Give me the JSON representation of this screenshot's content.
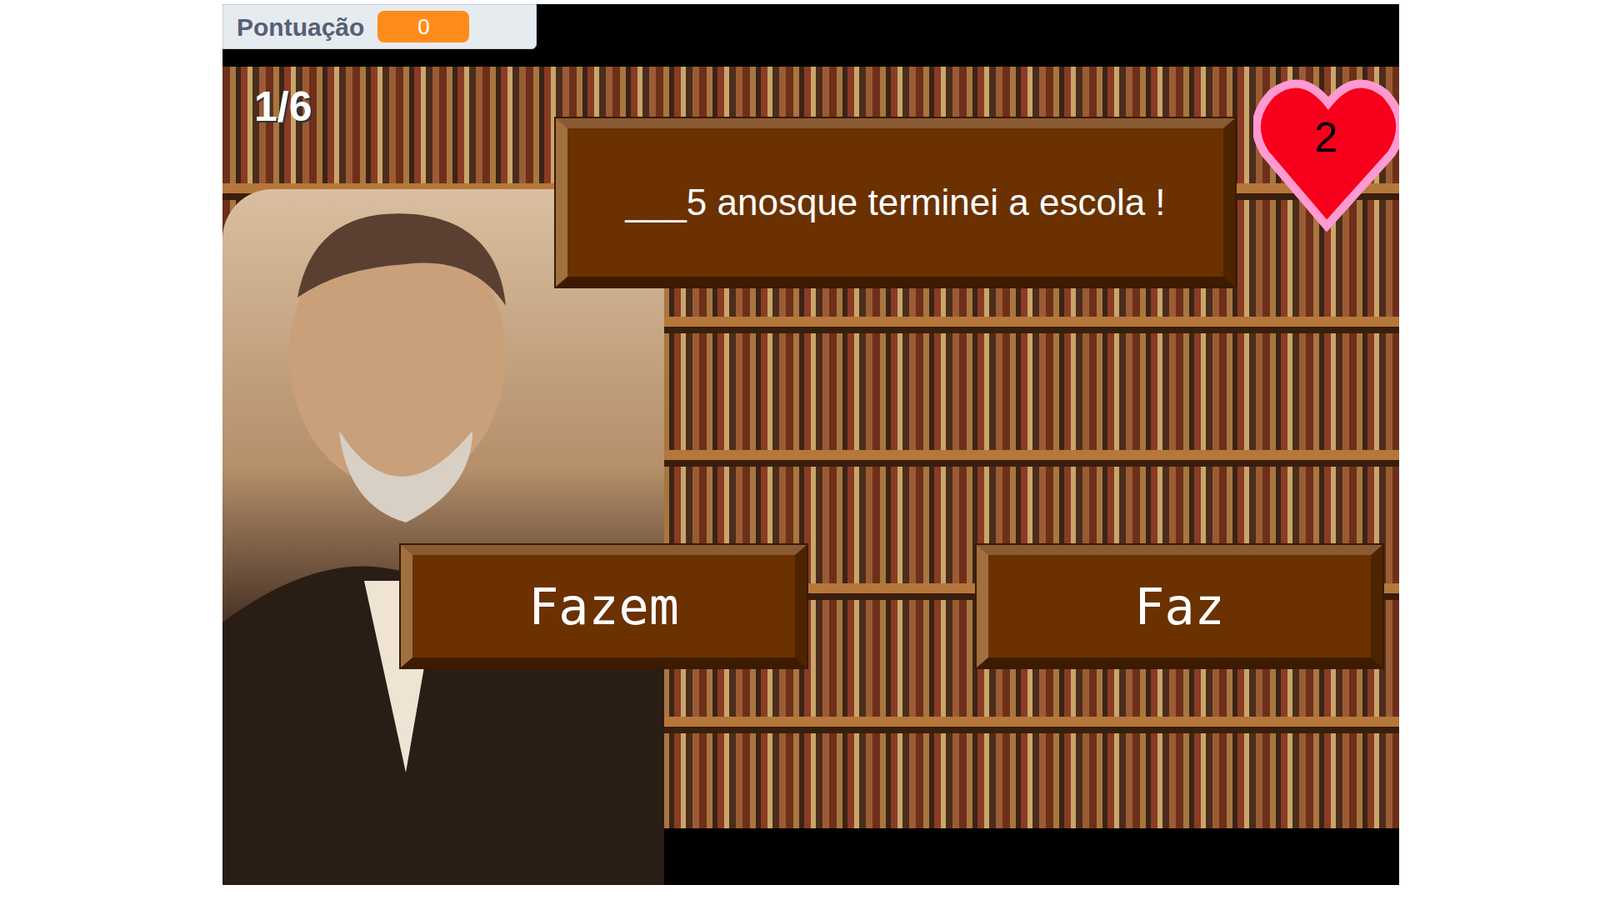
{
  "score_monitor": {
    "label": "Pontuação",
    "value": "0"
  },
  "progress": "1/6",
  "lives": "2",
  "question": "___5 anosque terminei a escola !",
  "answers": [
    {
      "label": "Fazem"
    },
    {
      "label": "Faz"
    }
  ]
}
